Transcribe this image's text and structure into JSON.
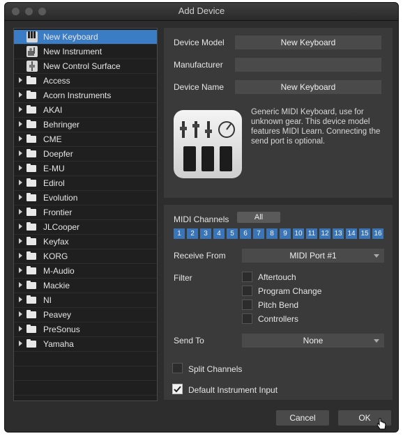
{
  "window": {
    "title": "Add Device"
  },
  "sidebar": {
    "devices": [
      {
        "label": "New Keyboard",
        "icon": "keyboard-icon",
        "selected": true
      },
      {
        "label": "New Instrument",
        "icon": "instrument-icon",
        "selected": false
      },
      {
        "label": "New Control Surface",
        "icon": "control-surface-icon",
        "selected": false
      }
    ],
    "folders": [
      "Access",
      "Acorn Instruments",
      "AKAI",
      "Behringer",
      "CME",
      "Doepfer",
      "E-MU",
      "Edirol",
      "Evolution",
      "Frontier",
      "JLCooper",
      "Keyfax",
      "KORG",
      "M-Audio",
      "Mackie",
      "NI",
      "Peavey",
      "PreSonus",
      "Yamaha"
    ]
  },
  "device": {
    "model_label": "Device Model",
    "model_value": "New Keyboard",
    "manufacturer_label": "Manufacturer",
    "manufacturer_value": "",
    "name_label": "Device Name",
    "name_value": "New Keyboard",
    "description": "Generic MIDI Keyboard, use for unknown gear. This device model features MIDI Learn. Connecting the send port is optional."
  },
  "midi": {
    "channels_label": "MIDI Channels",
    "all_label": "All",
    "channels": [
      "1",
      "2",
      "3",
      "4",
      "5",
      "6",
      "7",
      "8",
      "9",
      "10",
      "11",
      "12",
      "13",
      "14",
      "15",
      "16"
    ],
    "receive_label": "Receive From",
    "receive_value": "MIDI Port #1",
    "filter_label": "Filter",
    "filters": [
      {
        "label": "Aftertouch",
        "checked": false
      },
      {
        "label": "Program Change",
        "checked": false
      },
      {
        "label": "Pitch Bend",
        "checked": false
      },
      {
        "label": "Controllers",
        "checked": false
      }
    ],
    "send_label": "Send To",
    "send_value": "None",
    "split_label": "Split Channels",
    "split_checked": false,
    "default_input_label": "Default Instrument Input",
    "default_input_checked": true
  },
  "buttons": {
    "cancel": "Cancel",
    "ok": "OK"
  },
  "colors": {
    "selection": "#3b7dc4",
    "channel": "#3a75b8",
    "panel": "#3a3a3a",
    "window": "#2d2d2d"
  }
}
